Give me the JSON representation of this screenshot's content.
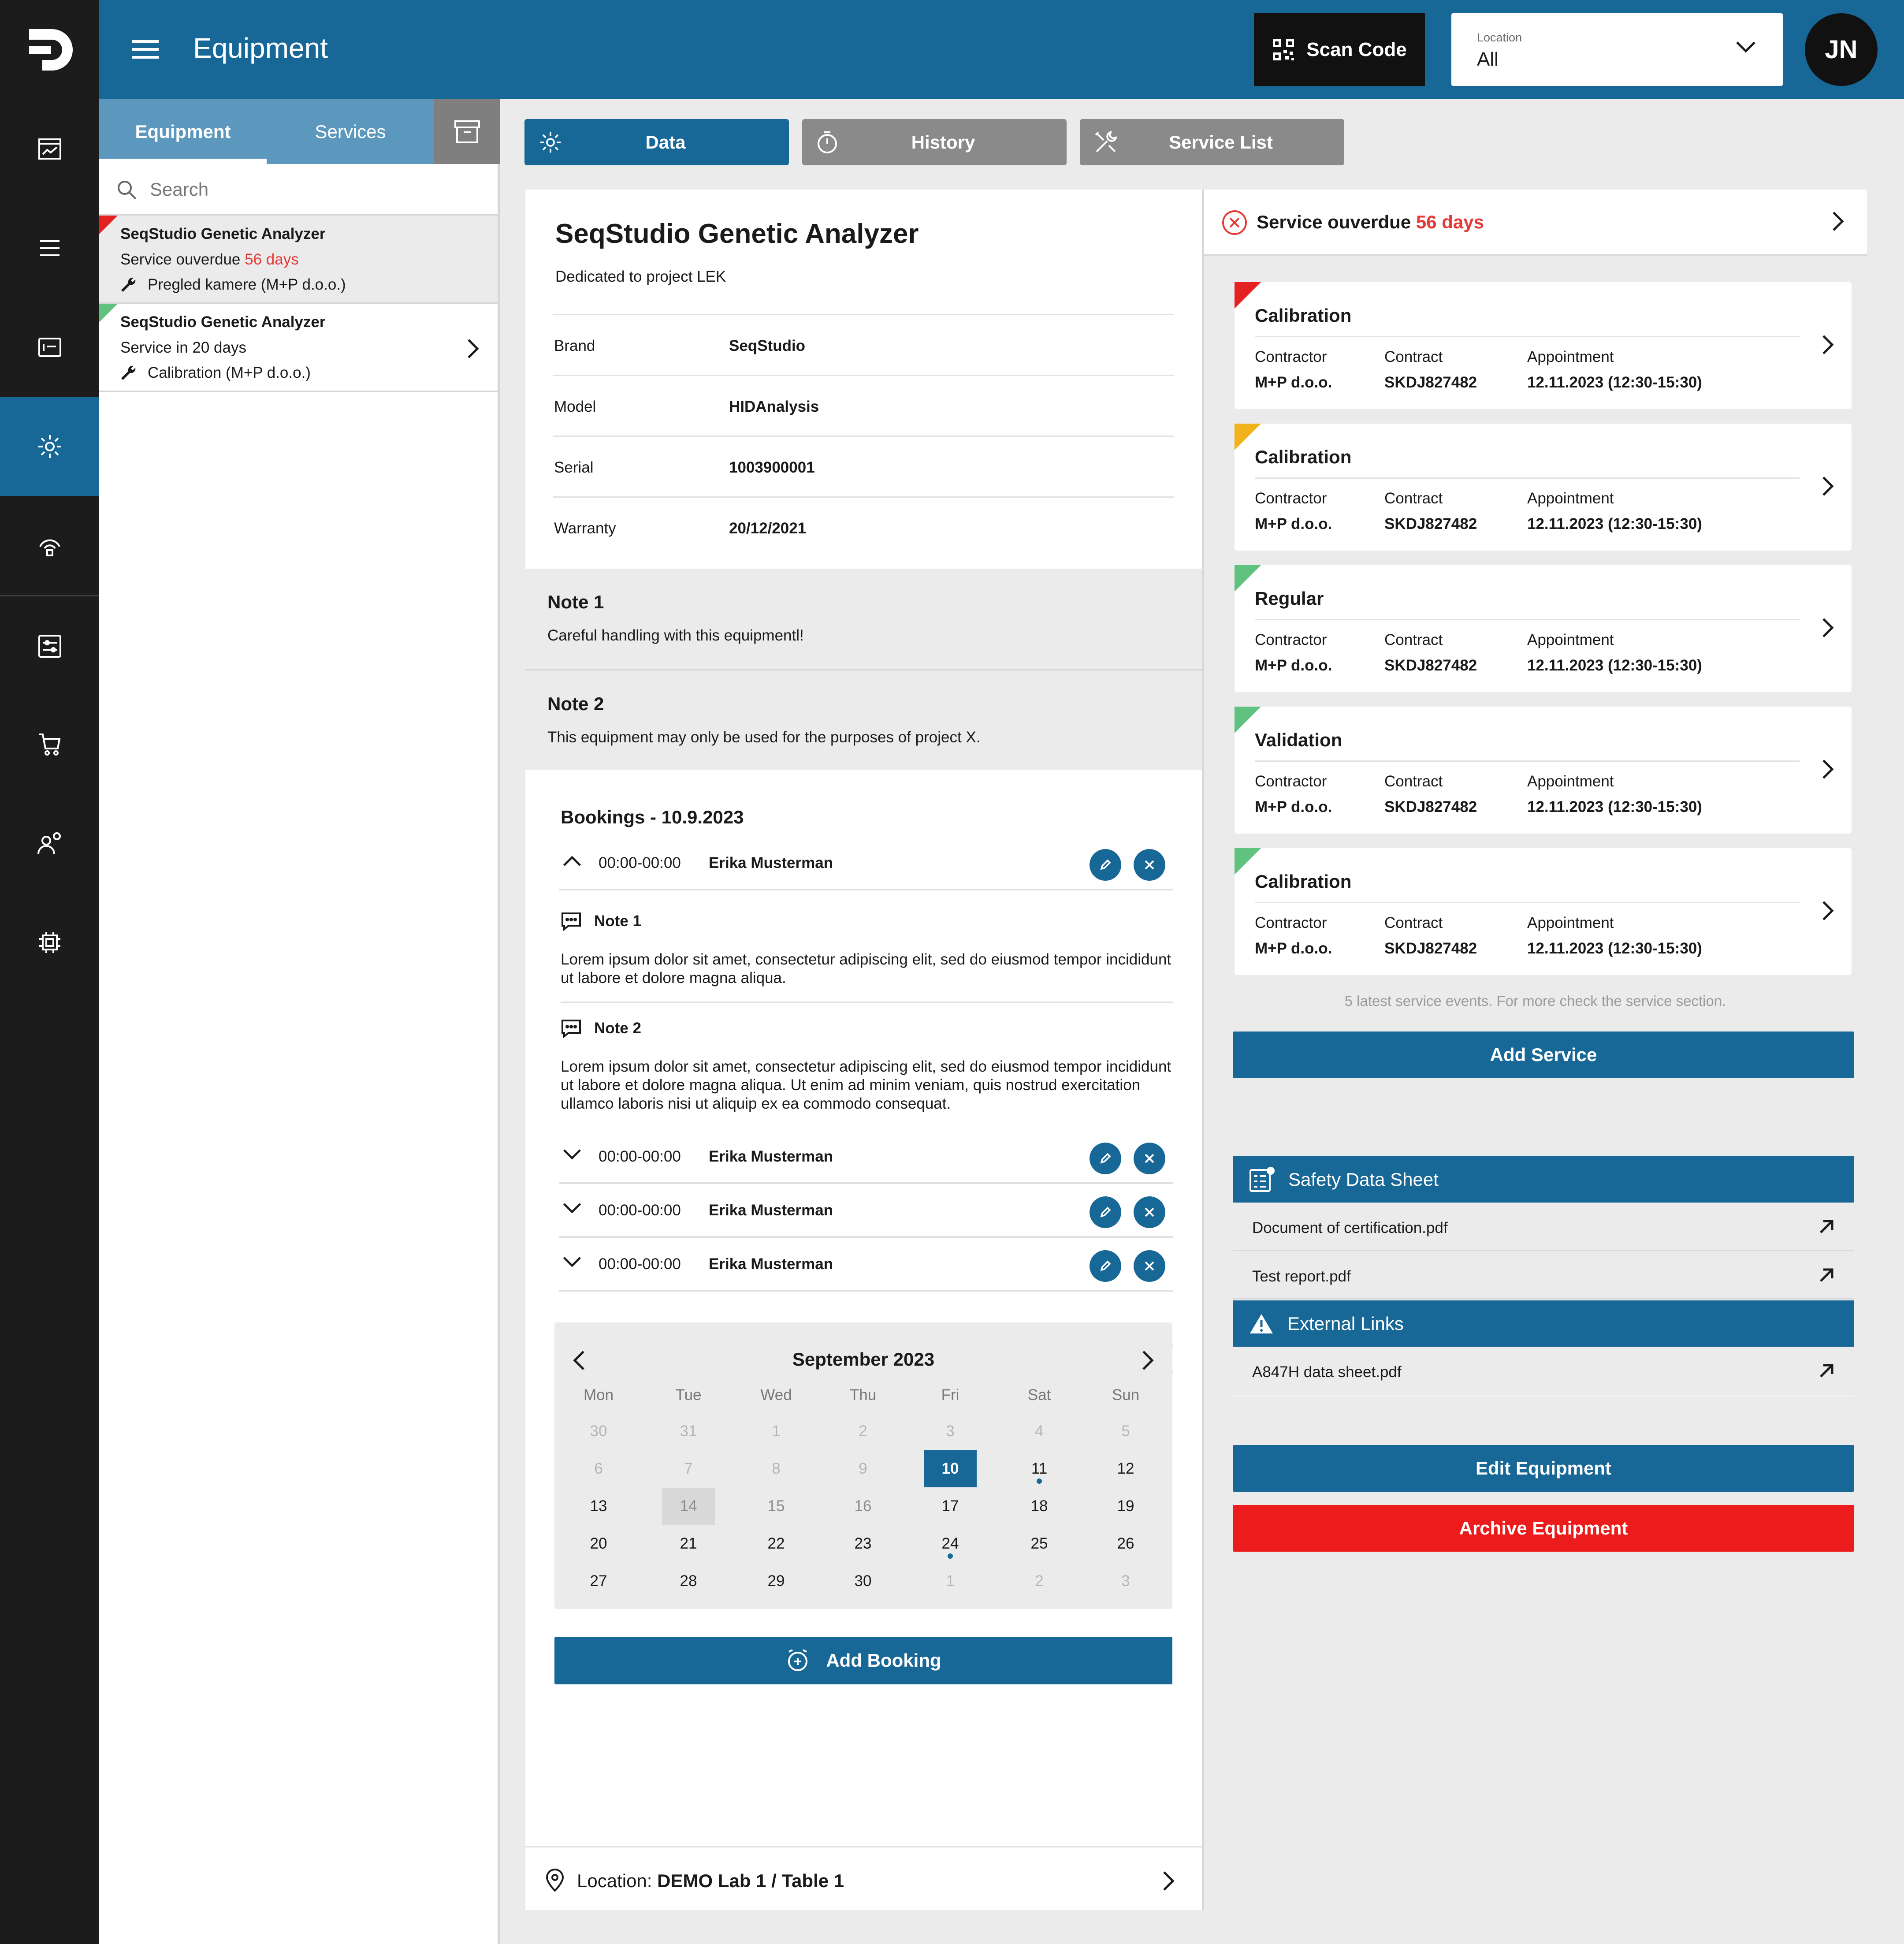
{
  "app": {
    "title": "Equipment",
    "avatar_initials": "JN"
  },
  "header": {
    "scan_label": "Scan Code",
    "location_label": "Location",
    "location_value": "All"
  },
  "list_panel": {
    "tabs": [
      {
        "label": "Equipment"
      },
      {
        "label": "Services"
      }
    ],
    "search_placeholder": "Search",
    "items": [
      {
        "name": "SeqStudio Genetic Analyzer",
        "status": "Service ouverdue",
        "days": "56 days",
        "task": "Pregled kamere (M+P d.o.o.)",
        "flag_color": "#e52222"
      },
      {
        "name": "SeqStudio Genetic Analyzer",
        "status": "Service in 20 days",
        "days": "",
        "task": "Calibration (M+P d.o.o.)",
        "flag_color": "#5fc27e"
      }
    ]
  },
  "main_tabs": [
    {
      "label": "Data"
    },
    {
      "label": "History"
    },
    {
      "label": "Service List"
    }
  ],
  "equipment": {
    "title": "SeqStudio Genetic Analyzer",
    "subtitle": "Dedicated to project LEK",
    "specs": [
      {
        "label": "Brand",
        "value": "SeqStudio"
      },
      {
        "label": "Model",
        "value": "HIDAnalysis"
      },
      {
        "label": "Serial",
        "value": "1003900001"
      },
      {
        "label": "Warranty",
        "value": "20/12/2021"
      }
    ],
    "notes": [
      {
        "title": "Note 1",
        "text": "Careful handling with this equipmentl!"
      },
      {
        "title": "Note 2",
        "text": "This equipment may only be used for the purposes of project X."
      }
    ]
  },
  "bookings": {
    "title": "Bookings - 10.9.2023",
    "rows": [
      {
        "time": "00:00-00:00",
        "name": "Erika Musterman"
      },
      {
        "time": "00:00-00:00",
        "name": "Erika Musterman"
      },
      {
        "time": "00:00-00:00",
        "name": "Erika Musterman"
      },
      {
        "time": "00:00-00:00",
        "name": "Erika Musterman"
      }
    ],
    "expanded_notes": [
      {
        "title": "Note 1",
        "text": "Lorem ipsum dolor sit amet, consectetur adipiscing elit, sed do eiusmod tempor incididunt ut labore et dolore magna aliqua."
      },
      {
        "title": "Note 2",
        "text": "Lorem ipsum dolor sit amet, consectetur adipiscing elit, sed do eiusmod tempor incididunt ut labore et dolore magna aliqua. Ut enim ad minim veniam, quis nostrud exercitation ullamco laboris nisi ut aliquip ex ea commodo consequat."
      }
    ],
    "add_label": "Add Booking"
  },
  "calendar": {
    "month": "September 2023",
    "weekdays": [
      "Mon",
      "Tue",
      "Wed",
      "Thu",
      "Fri",
      "Sat",
      "Sun"
    ],
    "weeks": [
      [
        "30",
        "31",
        "1",
        "2",
        "3",
        "4",
        "5"
      ],
      [
        "6",
        "7",
        "8",
        "9",
        "10",
        "11",
        "12"
      ],
      [
        "13",
        "14",
        "15",
        "16",
        "17",
        "18",
        "19"
      ],
      [
        "20",
        "21",
        "22",
        "23",
        "24",
        "25",
        "26"
      ],
      [
        "27",
        "28",
        "29",
        "30",
        "1",
        "2",
        "3"
      ]
    ],
    "selected_day": "10",
    "booked_days": [
      "11",
      "24"
    ]
  },
  "location": {
    "label": "Location:",
    "value": "DEMO Lab 1 / Table 1"
  },
  "service": {
    "overdue_label": "Service ouverdue",
    "overdue_days": "56 days",
    "field_labels": {
      "contractor": "Contractor",
      "contract": "Contract",
      "appointment": "Appointment"
    },
    "cards": [
      {
        "title": "Calibration",
        "flag_color": "#e52222",
        "contractor": "M+P d.o.o.",
        "contract": "SKDJ827482",
        "appointment": "12.11.2023 (12:30-15:30)"
      },
      {
        "title": "Calibration",
        "flag_color": "#f2b21c",
        "contractor": "M+P d.o.o.",
        "contract": "SKDJ827482",
        "appointment": "12.11.2023 (12:30-15:30)"
      },
      {
        "title": "Regular",
        "flag_color": "#5fc27e",
        "contractor": "M+P d.o.o.",
        "contract": "SKDJ827482",
        "appointment": "12.11.2023 (12:30-15:30)"
      },
      {
        "title": "Validation",
        "flag_color": "#5fc27e",
        "contractor": "M+P d.o.o.",
        "contract": "SKDJ827482",
        "appointment": "12.11.2023 (12:30-15:30)"
      },
      {
        "title": "Calibration",
        "flag_color": "#5fc27e",
        "contractor": "M+P d.o.o.",
        "contract": "SKDJ827482",
        "appointment": "12.11.2023 (12:30-15:30)"
      }
    ],
    "hint": "5 latest service events. For more check the service section.",
    "add_label": "Add Service"
  },
  "documents": {
    "safety_title": "Safety Data Sheet",
    "safety_files": [
      "Document of certification.pdf",
      "Test report.pdf"
    ],
    "links_title": "External Links",
    "link_files": [
      "A847H data sheet.pdf"
    ]
  },
  "actions": {
    "edit_label": "Edit Equipment",
    "archive_label": "Archive Equipment"
  },
  "colors": {
    "primary": "#176797",
    "danger": "#ec1c1c",
    "overdue": "#e53935",
    "rail": "#1c1c1c"
  }
}
